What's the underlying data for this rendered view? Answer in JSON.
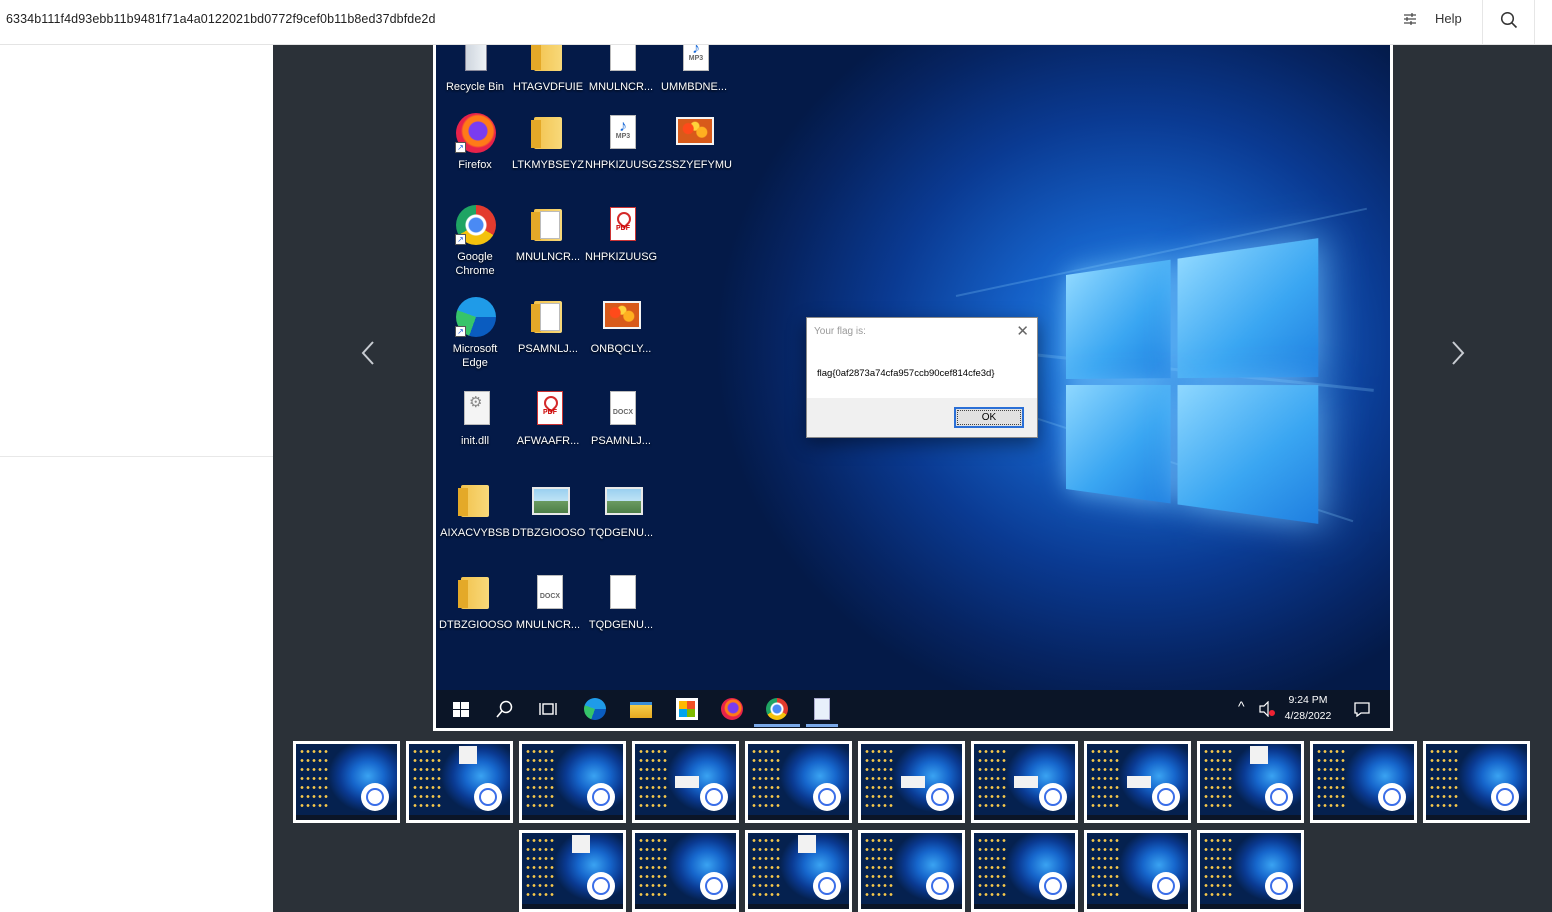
{
  "header": {
    "title": "6334b111f4d93ebb11b9481f71a4a0122021bd0772f9cef0b11b8ed37dbfde2d",
    "help_label": "Help"
  },
  "icons": {
    "filter": "sliders-icon",
    "search": "search-icon",
    "prev": "chevron-left-icon",
    "next": "chevron-right-icon"
  },
  "desktop": {
    "icons": [
      {
        "label": "Recycle Bin",
        "type": "recycle"
      },
      {
        "label": "HTAGVDFUIE",
        "type": "folder"
      },
      {
        "label": "MNULNCR...",
        "type": "doc"
      },
      {
        "label": "UMMBDNE...",
        "type": "mp3"
      },
      {
        "label": "Firefox",
        "type": "firefox"
      },
      {
        "label": "LTKMYBSEYZ",
        "type": "folder"
      },
      {
        "label": "NHPKIZUUSG",
        "type": "mp3"
      },
      {
        "label": "ZSSZYEFYMU",
        "type": "image"
      },
      {
        "label": "Google Chrome",
        "type": "chrome"
      },
      {
        "label": "MNULNCR...",
        "type": "folder-doc"
      },
      {
        "label": "NHPKIZUUSG",
        "type": "pdf"
      },
      {
        "label": "Microsoft Edge",
        "type": "edge"
      },
      {
        "label": "PSAMNLJ...",
        "type": "folder-doc"
      },
      {
        "label": "ONBQCLY...",
        "type": "image"
      },
      {
        "label": "init.dll",
        "type": "dll"
      },
      {
        "label": "AFWAAFR...",
        "type": "pdf"
      },
      {
        "label": "PSAMNLJ...",
        "type": "docx"
      },
      {
        "label": "AIXACVYBSB",
        "type": "folder"
      },
      {
        "label": "DTBZGIOOSO",
        "type": "picture"
      },
      {
        "label": "TQDGENU...",
        "type": "picture"
      },
      {
        "label": "DTBZGIOOSO",
        "type": "folder"
      },
      {
        "label": "MNULNCR...",
        "type": "docx"
      },
      {
        "label": "TQDGENU...",
        "type": "blank"
      }
    ]
  },
  "dialog": {
    "title": "Your flag is:",
    "message": "flag{0af2873a74cfa957ccb90cef814cfe3d}",
    "ok_label": "OK"
  },
  "taskbar": {
    "time": "9:24 PM",
    "date": "4/28/2022",
    "apps": [
      "windows-start-icon",
      "search-icon",
      "task-view-icon",
      "edge-icon",
      "file-explorer-icon",
      "store-icon",
      "firefox-icon",
      "chrome-icon",
      "notepad-icon"
    ]
  },
  "colors": {
    "viewer_bg": "#2b3138",
    "taskbar_bg": "#0b1527",
    "accent": "#2a6fd6"
  }
}
